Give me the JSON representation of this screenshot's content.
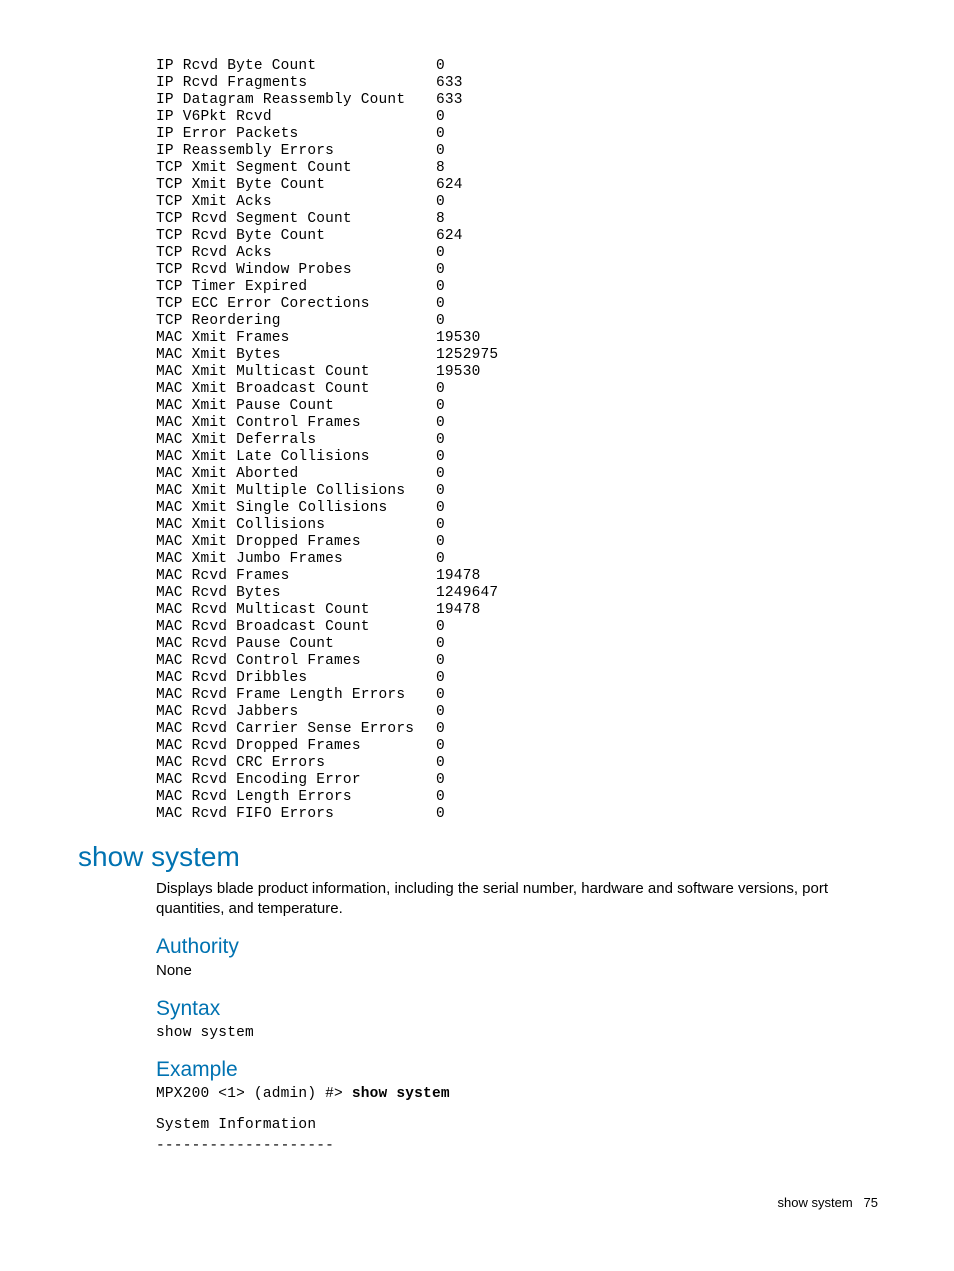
{
  "stats": [
    {
      "label": "IP Rcvd Byte Count",
      "value": "0"
    },
    {
      "label": "IP Rcvd Fragments",
      "value": "633"
    },
    {
      "label": "IP Datagram Reassembly Count",
      "value": "633"
    },
    {
      "label": "IP V6Pkt Rcvd",
      "value": "0"
    },
    {
      "label": "IP Error Packets",
      "value": "0"
    },
    {
      "label": "IP Reassembly Errors",
      "value": "0"
    },
    {
      "label": "TCP Xmit Segment Count",
      "value": "8"
    },
    {
      "label": "TCP Xmit Byte Count",
      "value": "624"
    },
    {
      "label": "TCP Xmit Acks",
      "value": "0"
    },
    {
      "label": "TCP Rcvd Segment Count",
      "value": "8"
    },
    {
      "label": "TCP Rcvd Byte Count",
      "value": "624"
    },
    {
      "label": "TCP Rcvd Acks",
      "value": "0"
    },
    {
      "label": "TCP Rcvd Window Probes",
      "value": "0"
    },
    {
      "label": "TCP Timer Expired",
      "value": "0"
    },
    {
      "label": "TCP ECC Error Corections",
      "value": "0"
    },
    {
      "label": "TCP Reordering",
      "value": "0"
    },
    {
      "label": "MAC Xmit Frames",
      "value": "19530"
    },
    {
      "label": "MAC Xmit Bytes",
      "value": "1252975"
    },
    {
      "label": "MAC Xmit Multicast Count",
      "value": "19530"
    },
    {
      "label": "MAC Xmit Broadcast Count",
      "value": "0"
    },
    {
      "label": "MAC Xmit Pause Count",
      "value": "0"
    },
    {
      "label": "MAC Xmit Control Frames",
      "value": "0"
    },
    {
      "label": "MAC Xmit Deferrals",
      "value": "0"
    },
    {
      "label": "MAC Xmit Late Collisions",
      "value": "0"
    },
    {
      "label": "MAC Xmit Aborted",
      "value": "0"
    },
    {
      "label": "MAC Xmit Multiple Collisions",
      "value": "0"
    },
    {
      "label": "MAC Xmit Single Collisions",
      "value": "0"
    },
    {
      "label": "MAC Xmit Collisions",
      "value": "0"
    },
    {
      "label": "MAC Xmit Dropped Frames",
      "value": "0"
    },
    {
      "label": "MAC Xmit Jumbo Frames",
      "value": "0"
    },
    {
      "label": "MAC Rcvd Frames",
      "value": "19478"
    },
    {
      "label": "MAC Rcvd Bytes",
      "value": "1249647"
    },
    {
      "label": "MAC Rcvd Multicast Count",
      "value": "19478"
    },
    {
      "label": "MAC Rcvd Broadcast Count",
      "value": "0"
    },
    {
      "label": "MAC Rcvd Pause Count",
      "value": "0"
    },
    {
      "label": "MAC Rcvd Control Frames",
      "value": "0"
    },
    {
      "label": "MAC Rcvd Dribbles",
      "value": "0"
    },
    {
      "label": "MAC Rcvd Frame Length Errors",
      "value": "0"
    },
    {
      "label": "MAC Rcvd Jabbers",
      "value": "0"
    },
    {
      "label": "MAC Rcvd Carrier Sense Errors",
      "value": "0"
    },
    {
      "label": "MAC Rcvd Dropped Frames",
      "value": "0"
    },
    {
      "label": "MAC Rcvd CRC Errors",
      "value": "0"
    },
    {
      "label": "MAC Rcvd Encoding Error",
      "value": "0"
    },
    {
      "label": "MAC Rcvd Length Errors",
      "value": "0"
    },
    {
      "label": "MAC Rcvd FIFO Errors",
      "value": "0"
    }
  ],
  "command": {
    "heading": "show system",
    "description": "Displays blade product information, including the serial number, hardware and software versions, port quantities, and temperature.",
    "authority_heading": "Authority",
    "authority_value": "None",
    "syntax_heading": "Syntax",
    "syntax_value": "show system",
    "example_heading": "Example",
    "example_prompt": "MPX200 <1> (admin) #> ",
    "example_cmd": "show system",
    "example_output_1": "System Information",
    "example_output_2": "--------------------"
  },
  "footer": {
    "label": "show system",
    "page": "75"
  }
}
